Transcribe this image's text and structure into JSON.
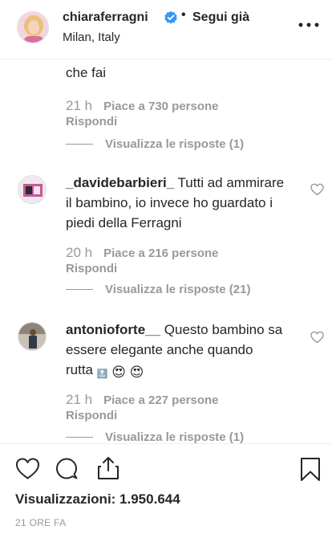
{
  "header": {
    "username": "chiaraferragni",
    "separator": "•",
    "follow_label": "Segui già",
    "location": "Milan, Italy"
  },
  "comments": [
    {
      "text": "che fai",
      "time": "21 h",
      "likes": "Piace a 730 persone",
      "reply_label": "Rispondi",
      "view_replies": "Visualizza le risposte (1)"
    },
    {
      "username": "_davidebarbieri_",
      "text_line1": "Tutti ad ammirare",
      "text_line2": "il bambino, io invece ho guardato i",
      "text_line3": "piedi della Ferragni",
      "time": "20 h",
      "likes": "Piace a 216 persone",
      "reply_label": "Rispondi",
      "view_replies": "Visualizza le risposte (21)"
    },
    {
      "username": "antonioforte__",
      "text_line1": "Questo bambino sa",
      "text_line2": "essere elegante anche quando",
      "text_line3": "rutta",
      "emoji_top": "🔝",
      "emoji_hearteyes_1": "😍",
      "emoji_hearteyes_2": "😍",
      "time": "21 h",
      "likes": "Piace a 227 persone",
      "reply_label": "Rispondi",
      "view_replies": "Visualizza le risposte (1)"
    }
  ],
  "footer": {
    "views": "Visualizzazioni: 1.950.644",
    "posted_ago": "21 ORE FA"
  },
  "icons": {
    "verified": "verified-badge-icon",
    "more": "more-options-icon",
    "like": "heart-icon",
    "comment": "comment-icon",
    "share": "share-icon",
    "save": "bookmark-icon"
  },
  "colors": {
    "text": "#262626",
    "secondary": "#999999",
    "verified": "#3897f0",
    "divider": "#efefef"
  }
}
